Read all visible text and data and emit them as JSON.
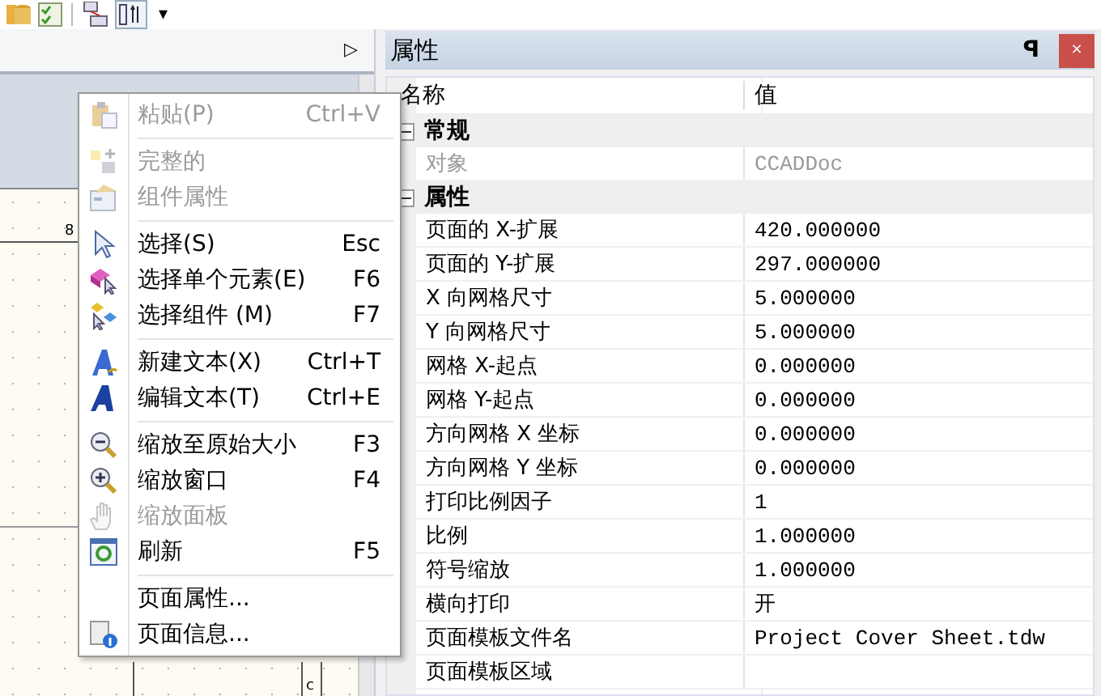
{
  "toolbar": {
    "overflow": "▾"
  },
  "document": {
    "scroll_arrow": "▷",
    "canvas_labels": [
      {
        "kind": "number",
        "text": "8"
      },
      {
        "kind": "letter",
        "text": "c"
      }
    ]
  },
  "context_menu": [
    {
      "kind": "item",
      "label": "粘贴(P)",
      "shortcut": "Ctrl+V",
      "disabled": true
    },
    {
      "kind": "separator"
    },
    {
      "kind": "item",
      "label": "完整的",
      "disabled": true
    },
    {
      "kind": "item",
      "label": "组件属性",
      "disabled": true
    },
    {
      "kind": "separator"
    },
    {
      "kind": "item",
      "label": "选择(S)",
      "shortcut": "Esc",
      "disabled": false
    },
    {
      "kind": "item",
      "label": "选择单个元素(E)",
      "shortcut": "F6",
      "disabled": false
    },
    {
      "kind": "item",
      "label": "选择组件 (M)",
      "shortcut": "F7",
      "disabled": false
    },
    {
      "kind": "separator"
    },
    {
      "kind": "item",
      "label": "新建文本(X)",
      "shortcut": "Ctrl+T",
      "disabled": false
    },
    {
      "kind": "item",
      "label": "编辑文本(T)",
      "shortcut": "Ctrl+E",
      "disabled": false
    },
    {
      "kind": "separator"
    },
    {
      "kind": "item",
      "label": "缩放至原始大小",
      "shortcut": "F3",
      "disabled": false
    },
    {
      "kind": "item",
      "label": "缩放窗口",
      "shortcut": "F4",
      "disabled": false
    },
    {
      "kind": "item",
      "label": "缩放面板",
      "disabled": true
    },
    {
      "kind": "item",
      "label": "刷新",
      "shortcut": "F5",
      "disabled": false
    },
    {
      "kind": "separator"
    },
    {
      "kind": "item",
      "label": "页面属性...",
      "disabled": false
    },
    {
      "kind": "item",
      "label": "页面信息...",
      "disabled": false
    }
  ],
  "properties_panel": {
    "title": "属性",
    "pin": "ꟼ",
    "close": "×",
    "columns": [
      "名称",
      "值"
    ],
    "groups": [
      {
        "name": "常规",
        "expanded": true,
        "rows": [
          {
            "name": "对象",
            "value": "CCADDoc",
            "disabled": true
          }
        ]
      },
      {
        "name": "属性",
        "expanded": true,
        "rows": [
          {
            "name": "页面的 X-扩展",
            "value": "420.000000",
            "disabled": false
          },
          {
            "name": "页面的 Y-扩展",
            "value": "297.000000",
            "disabled": false
          },
          {
            "name": "X 向网格尺寸",
            "value": "5.000000",
            "disabled": false
          },
          {
            "name": "Y 向网格尺寸",
            "value": "5.000000",
            "disabled": false
          },
          {
            "name": "网格 X-起点",
            "value": "0.000000",
            "disabled": false
          },
          {
            "name": "网格 Y-起点",
            "value": "0.000000",
            "disabled": false
          },
          {
            "name": "方向网格 X 坐标",
            "value": "0.000000",
            "disabled": false
          },
          {
            "name": "方向网格 Y 坐标",
            "value": "0.000000",
            "disabled": false
          },
          {
            "name": "打印比例因子",
            "value": "1",
            "disabled": false
          },
          {
            "name": "比例",
            "value": "1.000000",
            "disabled": false
          },
          {
            "name": "符号缩放",
            "value": "1.000000",
            "disabled": false
          },
          {
            "name": "横向打印",
            "value": "开",
            "disabled": false
          },
          {
            "name": "页面模板文件名",
            "value": "Project Cover Sheet.tdw",
            "disabled": false
          },
          {
            "name": "页面模板区域",
            "disabled": false
          }
        ]
      }
    ]
  }
}
